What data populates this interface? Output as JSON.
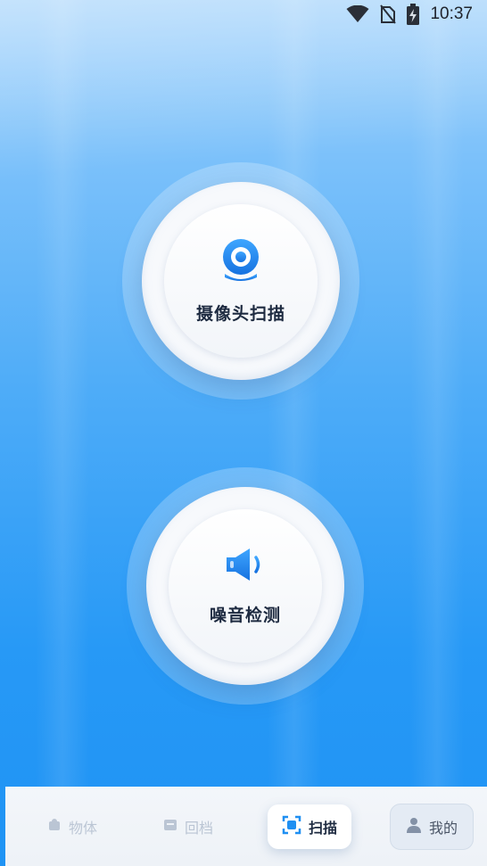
{
  "status_bar": {
    "time": "10:37",
    "icons": [
      "wifi-icon",
      "no-sim-icon",
      "battery-charging-icon"
    ]
  },
  "actions": [
    {
      "label": "摄像头扫描",
      "icon": "webcam-icon"
    },
    {
      "label": "噪音检测",
      "icon": "speaker-icon"
    }
  ],
  "bottom_nav": {
    "items": [
      {
        "label": "物体",
        "icon": "object-icon",
        "state": "faded"
      },
      {
        "label": "回档",
        "icon": "record-icon",
        "state": "faded"
      },
      {
        "label": "扫描",
        "icon": "scan-icon",
        "state": "active"
      },
      {
        "label": "我的",
        "icon": "user-icon",
        "state": "normal"
      }
    ]
  },
  "colors": {
    "accent": "#1f8ff2",
    "text_dark": "#1d2a40",
    "background_top": "#a6d4fb",
    "background_bottom": "#1f93f4"
  }
}
